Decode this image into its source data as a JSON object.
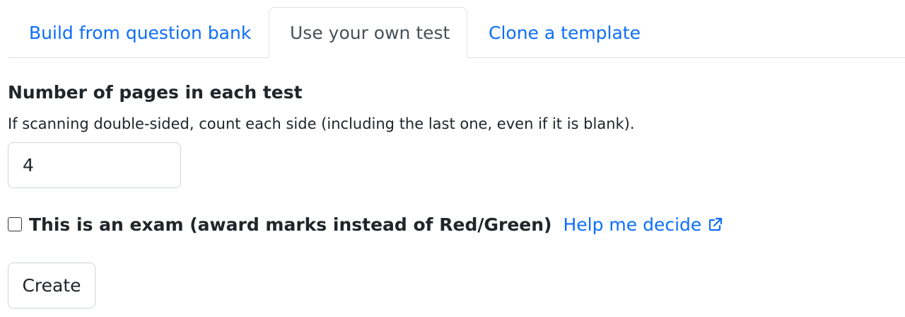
{
  "tabs": [
    {
      "label": "Build from question bank",
      "active": false
    },
    {
      "label": "Use your own test",
      "active": true
    },
    {
      "label": "Clone a template",
      "active": false
    }
  ],
  "pages": {
    "label": "Number of pages in each test",
    "help": "If scanning double-sided, count each side (including the last one, even if it is blank).",
    "value": "4"
  },
  "exam": {
    "checked": false,
    "label": "This is an exam (award marks instead of Red/Green)",
    "help_link": "Help me decide",
    "help_icon": "external-link-icon"
  },
  "actions": {
    "create_label": "Create"
  },
  "colors": {
    "link": "#0d6efd",
    "text": "#212529",
    "border": "#dee2e6"
  }
}
